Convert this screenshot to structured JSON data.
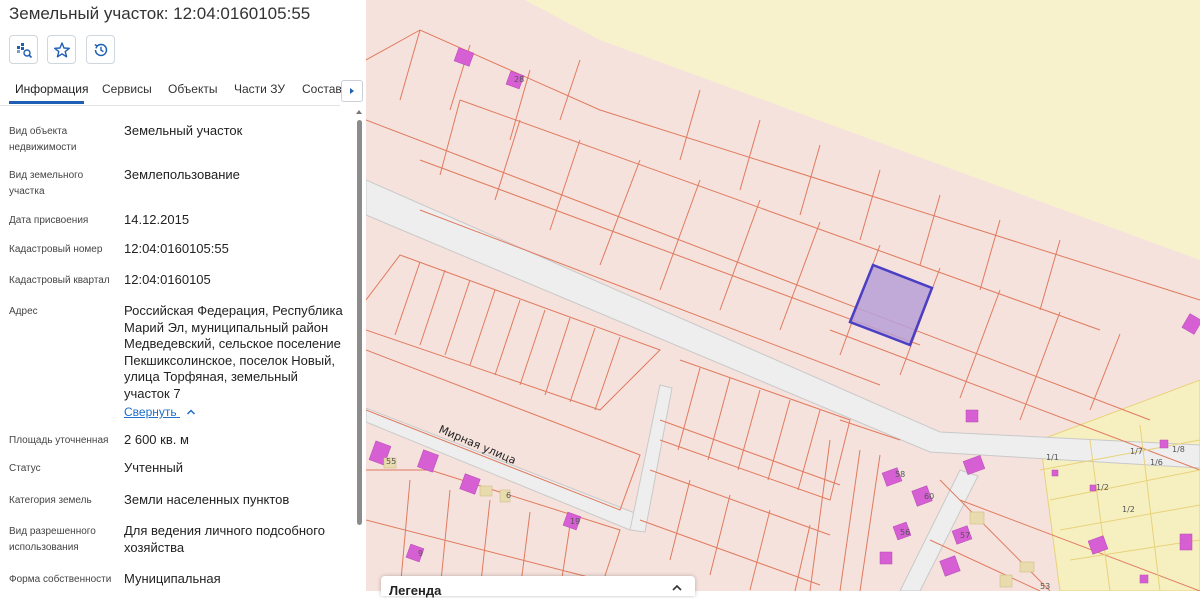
{
  "header": {
    "title": "Земельный участок: 12:04:0160105:55"
  },
  "toolbar": {
    "buttons": [
      {
        "icon": "zoom-to-parcel-icon"
      },
      {
        "icon": "star-icon"
      },
      {
        "icon": "history-icon"
      }
    ]
  },
  "tabs": [
    {
      "label": "Информация",
      "active": true
    },
    {
      "label": "Сервисы"
    },
    {
      "label": "Объекты"
    },
    {
      "label": "Части ЗУ"
    },
    {
      "label": "Состав"
    }
  ],
  "info": {
    "rows": [
      {
        "label": "Вид объекта недвижимости",
        "value": "Земельный участок"
      },
      {
        "label": "Вид земельного участка",
        "value": "Землепользование"
      },
      {
        "label": "Дата присвоения",
        "value": "14.12.2015"
      },
      {
        "label": "Кадастровый номер",
        "value": "12:04:0160105:55"
      },
      {
        "label": "Кадастровый квартал",
        "value": "12:04:0160105"
      },
      {
        "label": "Адрес",
        "value": "Российская Федерация, Республика Марий Эл, муниципальный район Медведевский, сельское поселение Пекшиксолинское, поселок Новый, улица Торфяная, земельный участок 7"
      },
      {
        "label": "Площадь уточненная",
        "value": "2 600 кв. м"
      },
      {
        "label": "Статус",
        "value": "Учтенный"
      },
      {
        "label": "Категория земель",
        "value": "Земли населенных пунктов"
      },
      {
        "label": "Вид разрешенного использования",
        "value": "Для ведения личного подсобного хозяйства"
      },
      {
        "label": "Форма собственности",
        "value": "Муниципальная"
      }
    ],
    "collapse_label": "Свернуть"
  },
  "map": {
    "street_label": "Мирная улица",
    "parcel_numbers": [
      "28",
      "55",
      "6",
      "19",
      "9",
      "58",
      "60",
      "56",
      "57",
      "53",
      "1/1",
      "1/2",
      "1/7",
      "1/6",
      "1/8",
      "1/2"
    ],
    "colors": {
      "background": "#f8f2cc",
      "parcel_fill": "#f6e2dc",
      "parcel_line": "#e07a5f",
      "selected_fill": "#b7a0d6",
      "selected_line": "#4b3fc4",
      "building": "#d65fd4"
    }
  },
  "legend": {
    "title": "Легенда"
  }
}
